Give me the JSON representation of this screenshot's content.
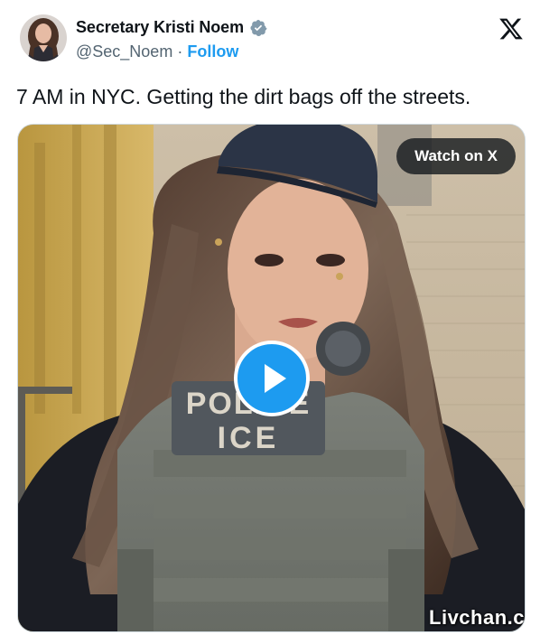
{
  "author": {
    "display_name": "Secretary Kristi Noem",
    "handle": "@Sec_Noem",
    "separator": "·",
    "follow_label": "Follow",
    "verified_color": "#829aab"
  },
  "tweet": {
    "text": "7 AM in NYC. Getting the dirt bags off the streets."
  },
  "media": {
    "watch_label": "Watch on X",
    "play_color": "#1d9bf0",
    "vest_patch_line1": "POLICE",
    "vest_patch_line2": "ICE"
  },
  "watermark": {
    "text": "Livchan.c"
  },
  "icons": {
    "logo": "x-logo-icon",
    "verified": "verified-badge-icon",
    "play": "play-icon"
  }
}
